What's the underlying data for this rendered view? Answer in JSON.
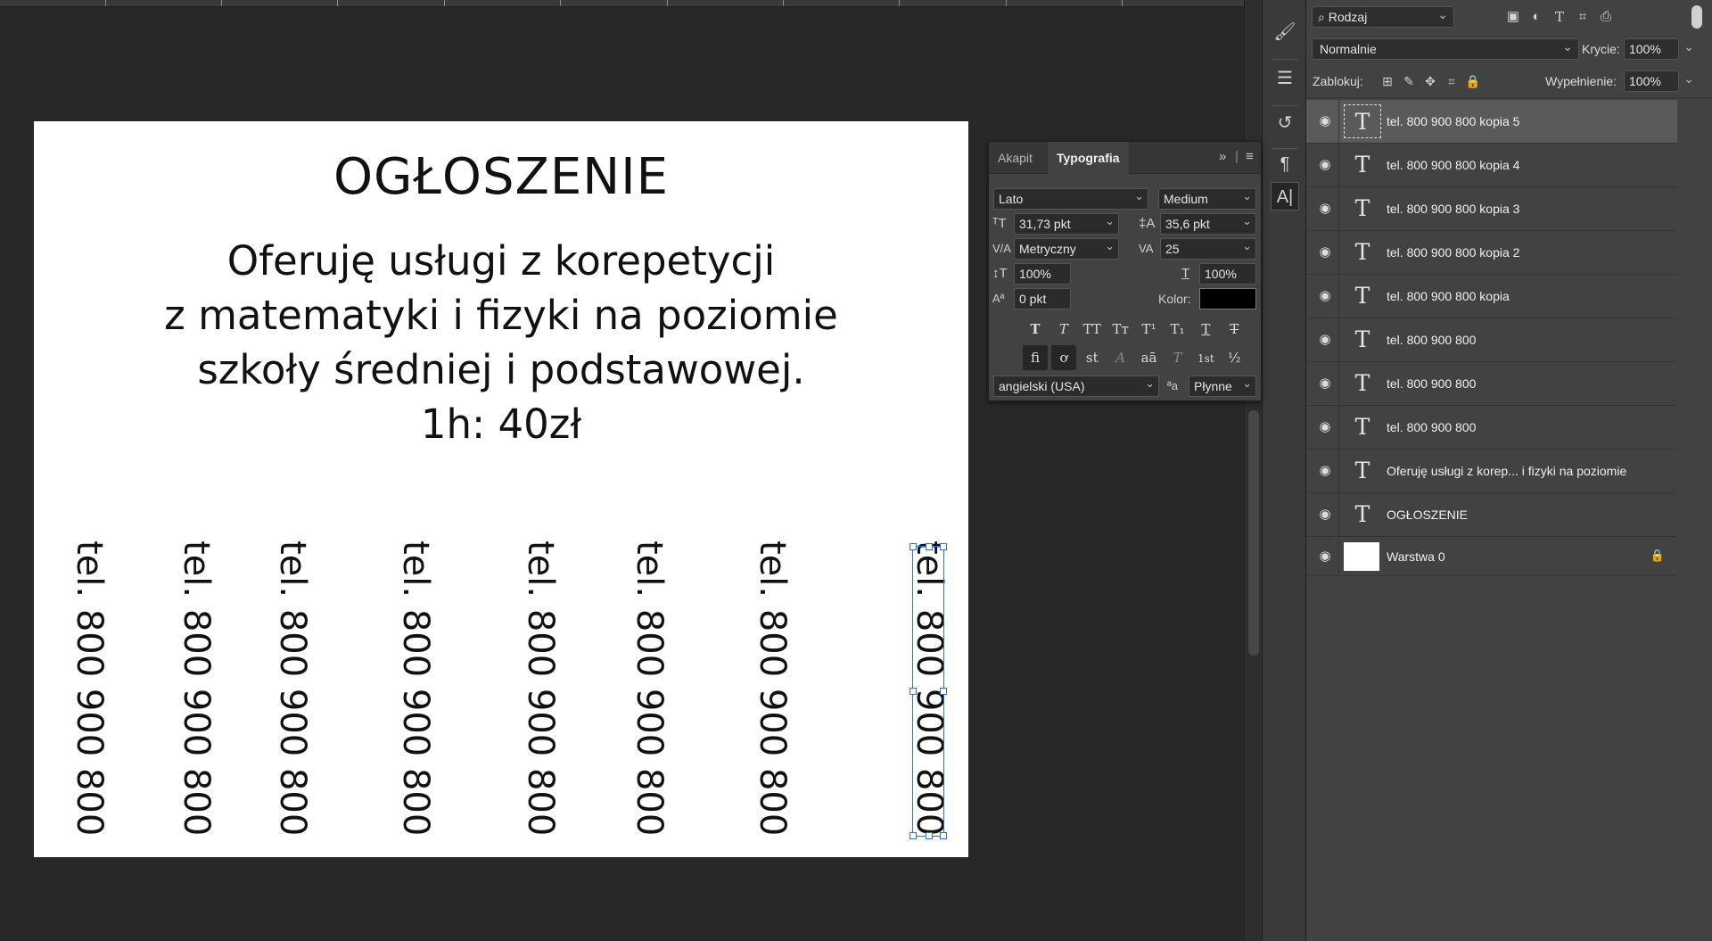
{
  "document": {
    "title": "OGŁOSZENIE",
    "body_lines": [
      "Oferuję usługi z korepetycji",
      "z matematyki i fizyki na poziomie",
      "szkoły średniej i podstawowej.",
      "1h: 40zł"
    ],
    "phone_text": "tel. 800 900 800"
  },
  "typography_panel": {
    "tabs": [
      "Akapit",
      "Typografia"
    ],
    "active_tab": "Typografia",
    "font_family": "Lato",
    "font_style": "Medium",
    "font_size": "31,73 pkt",
    "leading": "35,6 pkt",
    "kerning": "Metryczny",
    "tracking": "25",
    "vertical_scale": "100%",
    "horizontal_scale": "100%",
    "baseline_shift": "0 pkt",
    "color_label": "Kolor:",
    "color_value": "#000000",
    "language": "angielski (USA)",
    "antialias_icon": "ªa",
    "antialias": "Płynne",
    "style_buttons": [
      "T",
      "T",
      "TT",
      "Tт",
      "T¹",
      "T₁",
      "T",
      "T"
    ],
    "opentype_buttons": [
      "fi",
      "ơ",
      "st",
      "A",
      "aā",
      "T",
      "1st",
      "½"
    ]
  },
  "layers_panel": {
    "filter_kind": "Rodzaj",
    "blend_mode": "Normalnie",
    "opacity_label": "Krycie:",
    "opacity": "100%",
    "lock_label": "Zablokuj:",
    "fill_label": "Wypełnienie:",
    "fill": "100%",
    "layers": [
      {
        "name": "tel. 800 900 800 kopia 5",
        "type": "text",
        "selected": true
      },
      {
        "name": "tel. 800 900 800 kopia 4",
        "type": "text",
        "selected": false
      },
      {
        "name": "tel. 800 900 800 kopia 3",
        "type": "text",
        "selected": false
      },
      {
        "name": "tel. 800 900 800 kopia 2",
        "type": "text",
        "selected": false
      },
      {
        "name": "tel. 800 900 800 kopia",
        "type": "text",
        "selected": false
      },
      {
        "name": "tel. 800 900 800",
        "type": "text",
        "selected": false
      },
      {
        "name": "tel. 800 900 800",
        "type": "text",
        "selected": false
      },
      {
        "name": "tel. 800 900 800",
        "type": "text",
        "selected": false
      },
      {
        "name": "Oferuję usługi z korep... i fizyki na poziomie",
        "type": "text",
        "selected": false
      },
      {
        "name": "OGŁOSZENIE",
        "type": "text",
        "selected": false
      },
      {
        "name": "Warstwa 0",
        "type": "pixel",
        "selected": false,
        "locked": true
      }
    ]
  },
  "icons": {
    "layer_text_icon": "T",
    "eye_icon": "👁",
    "search_icon": "🔍",
    "lock_icon": "🔒"
  },
  "colors": {
    "workspace": "#282828",
    "panel": "#424242",
    "selection": "#2f6fcf"
  }
}
